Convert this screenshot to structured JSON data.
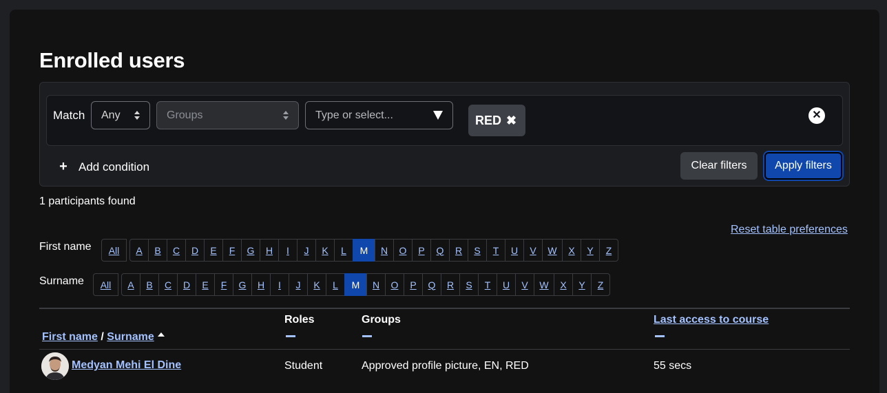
{
  "page": {
    "title": "Enrolled users"
  },
  "filter": {
    "match_label": "Match",
    "match_value": "Any",
    "type_value": "Groups",
    "value_placeholder": "Type or select...",
    "selected_tag": "RED",
    "tag_remove_glyph": "✖",
    "remove_row_glyph": "✕",
    "add_condition_icon": "+",
    "add_condition_label": "Add condition",
    "clear_label": "Clear filters",
    "apply_label": "Apply filters"
  },
  "participants_found": "1 participants found",
  "reset_link": "Reset table preferences",
  "firstname_bar": {
    "label": "First name",
    "all": "All",
    "active": "M",
    "letters": [
      "A",
      "B",
      "C",
      "D",
      "E",
      "F",
      "G",
      "H",
      "I",
      "J",
      "K",
      "L",
      "M",
      "N",
      "O",
      "P",
      "Q",
      "R",
      "S",
      "T",
      "U",
      "V",
      "W",
      "X",
      "Y",
      "Z"
    ]
  },
  "surname_bar": {
    "label": "Surname",
    "all": "All",
    "active": "M",
    "letters": [
      "A",
      "B",
      "C",
      "D",
      "E",
      "F",
      "G",
      "H",
      "I",
      "J",
      "K",
      "L",
      "M",
      "N",
      "O",
      "P",
      "Q",
      "R",
      "S",
      "T",
      "U",
      "V",
      "W",
      "X",
      "Y",
      "Z"
    ]
  },
  "table": {
    "col_firstname": "First name",
    "col_separator": " / ",
    "col_surname": "Surname",
    "col_roles": "Roles",
    "col_groups": "Groups",
    "col_lastaccess": "Last access to course",
    "rows": [
      {
        "name": "Medyan Mehi El Dine",
        "role": "Student",
        "groups": "Approved profile picture, EN, RED",
        "last_access": "55 secs"
      }
    ]
  },
  "colors": {
    "accent": "#0f47ad",
    "link": "#a4c2ff",
    "background": "#121212"
  }
}
